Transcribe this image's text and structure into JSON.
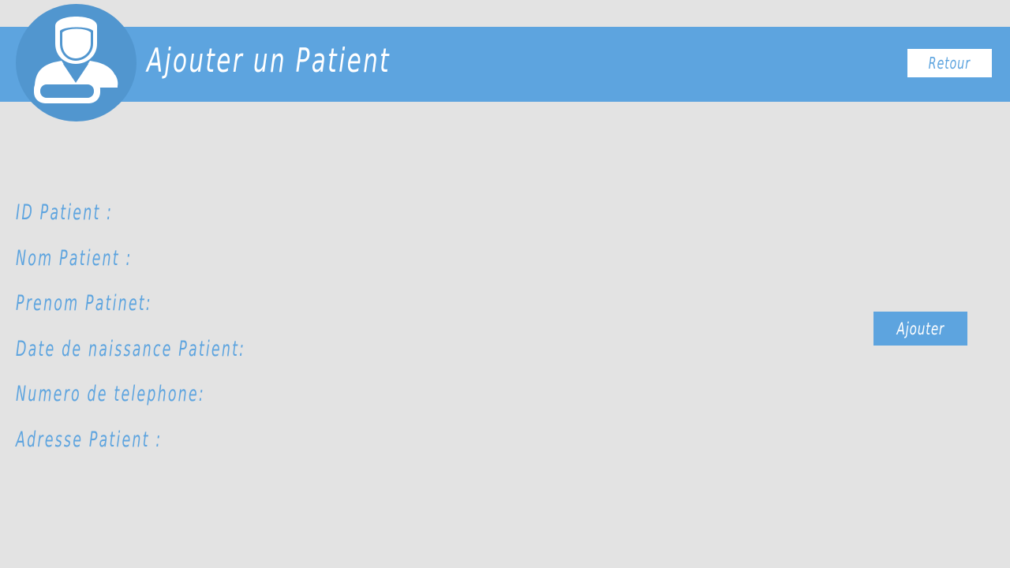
{
  "header": {
    "title": "Ajouter un Patient",
    "back_label": "Retour",
    "avatar_icon": "patient-icon"
  },
  "form": {
    "fields": [
      {
        "label": "ID Patient :"
      },
      {
        "label": "Nom Patient :"
      },
      {
        "label": "Prenom Patinet:"
      },
      {
        "label": "Date de naissance Patient:"
      },
      {
        "label": "Numero de telephone:"
      },
      {
        "label": "Adresse Patient :"
      }
    ],
    "submit_label": "Ajouter"
  },
  "colors": {
    "background": "#e3e3e3",
    "accent": "#5da4df",
    "avatar_circle": "#5196cf",
    "white": "#ffffff"
  }
}
